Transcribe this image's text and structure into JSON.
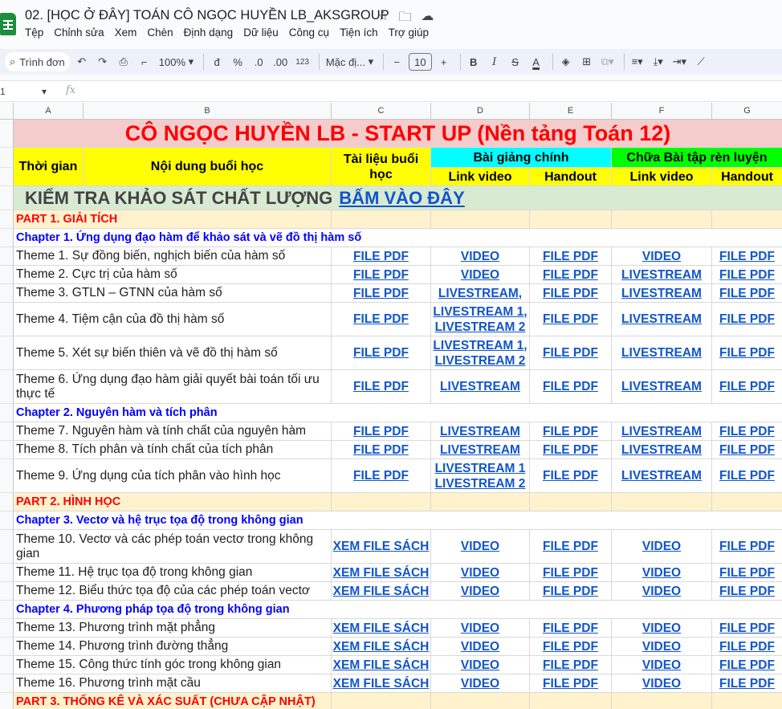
{
  "app": {
    "doc_title": "02. [HỌC Ở ĐÂY] TOÁN CÔ NGỌC HUYỀN LB_AKSGROUP",
    "menus": [
      "Tệp",
      "Chỉnh sửa",
      "Xem",
      "Chèn",
      "Định dạng",
      "Dữ liệu",
      "Công cụ",
      "Tiện ích",
      "Trợ giúp"
    ]
  },
  "toolbar": {
    "search_label": "Trình đơn",
    "zoom": "100%",
    "currency": "đ",
    "percent": "%",
    "dec_less": ".0",
    "dec_more": ".00",
    "number_format": "123",
    "font": "Mặc đị...",
    "font_size": "10",
    "bold": "B",
    "italic": "I",
    "strike": "S",
    "text_color": "A"
  },
  "formula_bar": {
    "cell_ref": "1",
    "fx": "fx"
  },
  "columns": [
    "A",
    "B",
    "C",
    "D",
    "E",
    "F",
    "G"
  ],
  "sheet": {
    "title": "CÔ NGỌC HUYỀN LB - START UP (Nền tảng Toán 12)",
    "headers": {
      "time": "Thời gian",
      "content": "Nội dung buổi học",
      "material": "Tài liệu buổi học",
      "main_lecture": "Bài giảng chính",
      "exercise": "Chữa Bài tập rèn luyện",
      "link_video": "Link video",
      "handout": "Handout"
    },
    "survey_text": "KIỂM TRA KHẢO SÁT CHẤT LƯỢNG",
    "survey_link": "BẤM VÀO ĐÂY",
    "rows": [
      {
        "kind": "part",
        "text": "PART 1. GIẢI TÍCH"
      },
      {
        "kind": "chapter",
        "text": "Chapter 1. Ứng dụng đạo hàm để khảo sát và vẽ đồ thị hàm số"
      },
      {
        "kind": "theme",
        "text": "Theme 1. Sự đồng biến, nghịch biến của hàm số",
        "c": "FILE PDF",
        "d": "VIDEO",
        "e": "FILE PDF",
        "f": "VIDEO",
        "g": "FILE PDF"
      },
      {
        "kind": "theme",
        "text": "Theme 2. Cực trị của hàm số",
        "c": "FILE PDF",
        "d": "VIDEO",
        "e": "FILE PDF",
        "f": "LIVESTREAM",
        "g": "FILE PDF"
      },
      {
        "kind": "theme",
        "text": "Theme 3. GTLN – GTNN của hàm số",
        "c": "FILE PDF",
        "d": "LIVESTREAM,",
        "e": "FILE PDF",
        "f": "LIVESTREAM",
        "g": "FILE PDF"
      },
      {
        "kind": "theme",
        "text": "Theme 4. Tiệm cận của đồ thị hàm số",
        "c": "FILE PDF",
        "d": "LIVESTREAM 1,\nLIVESTREAM 2",
        "e": "FILE PDF",
        "f": "LIVESTREAM",
        "g": "FILE PDF"
      },
      {
        "kind": "theme",
        "text": "Theme 5. Xét sự biến thiên và vẽ đồ thị hàm số",
        "c": "FILE PDF",
        "d": "LIVESTREAM 1,\nLIVESTREAM 2",
        "e": "FILE PDF",
        "f": "LIVESTREAM",
        "g": "FILE PDF"
      },
      {
        "kind": "theme",
        "text": "Theme 6. Ứng dụng đạo hàm giải quyết bài toán tối ưu thực tế",
        "c": "FILE PDF",
        "d": "LIVESTREAM",
        "e": "FILE PDF",
        "f": "LIVESTREAM",
        "g": "FILE PDF"
      },
      {
        "kind": "chapter",
        "text": "Chapter 2. Nguyên hàm và tích phân"
      },
      {
        "kind": "theme",
        "text": "Theme 7. Nguyên hàm và tính chất của nguyên hàm",
        "c": "FILE PDF",
        "d": "LIVESTREAM",
        "e": "FILE PDF",
        "f": "LIVESTREAM",
        "g": "FILE PDF"
      },
      {
        "kind": "theme",
        "text": "Theme 8. Tích phân và tính chất của tích phân",
        "c": "FILE PDF",
        "d": "LIVESTREAM",
        "e": "FILE PDF",
        "f": "LIVESTREAM",
        "g": "FILE PDF"
      },
      {
        "kind": "theme",
        "text": "Theme 9. Ứng dụng của tích phân vào hình học",
        "c": "FILE PDF",
        "d": "LIVESTREAM 1\nLIVESTREAM 2",
        "e": "FILE PDF",
        "f": "LIVESTREAM",
        "g": "FILE PDF"
      },
      {
        "kind": "part",
        "text": "PART 2. HÌNH HỌC"
      },
      {
        "kind": "chapter",
        "text": "Chapter 3. Vectơ và hệ trục tọa độ trong không gian"
      },
      {
        "kind": "theme",
        "text": "Theme 10. Vectơ và các phép toán vectơ trong không gian",
        "c": "XEM FILE SÁCH",
        "d": "VIDEO",
        "e": "FILE PDF",
        "f": "VIDEO",
        "g": "FILE PDF"
      },
      {
        "kind": "theme",
        "text": "Theme 11. Hệ trục tọa độ trong không gian",
        "c": "XEM FILE SÁCH",
        "d": "VIDEO",
        "e": "FILE PDF",
        "f": "VIDEO",
        "g": "FILE PDF"
      },
      {
        "kind": "theme",
        "text": "Theme 12. Biểu thức tọa độ của các phép toán vectơ",
        "c": "XEM FILE SÁCH",
        "d": "VIDEO",
        "e": "FILE PDF",
        "f": "VIDEO",
        "g": "FILE PDF"
      },
      {
        "kind": "chapter",
        "text": "Chapter 4. Phương pháp tọa độ trong không gian"
      },
      {
        "kind": "theme",
        "text": "Theme 13. Phương trình mặt phẳng",
        "c": "XEM FILE SÁCH",
        "d": "VIDEO",
        "e": "FILE PDF",
        "f": "VIDEO",
        "g": "FILE PDF"
      },
      {
        "kind": "theme",
        "text": "Theme 14. Phương trình đường thẳng",
        "c": "XEM FILE SÁCH",
        "d": "VIDEO",
        "e": "FILE PDF",
        "f": "VIDEO",
        "g": "FILE PDF"
      },
      {
        "kind": "theme",
        "text": "Theme 15. Công thức tính góc trong không gian",
        "c": "XEM FILE SÁCH",
        "d": "VIDEO",
        "e": "FILE PDF",
        "f": "VIDEO",
        "g": "FILE PDF"
      },
      {
        "kind": "theme",
        "text": "Theme 16. Phương trình mặt cầu",
        "c": "XEM FILE SÁCH",
        "d": "VIDEO",
        "e": "FILE PDF",
        "f": "VIDEO",
        "g": "FILE PDF"
      },
      {
        "kind": "part",
        "text": "PART 3. THỐNG KÊ VÀ XÁC SUẤT (CHƯA CẬP NHẬT)"
      }
    ]
  }
}
